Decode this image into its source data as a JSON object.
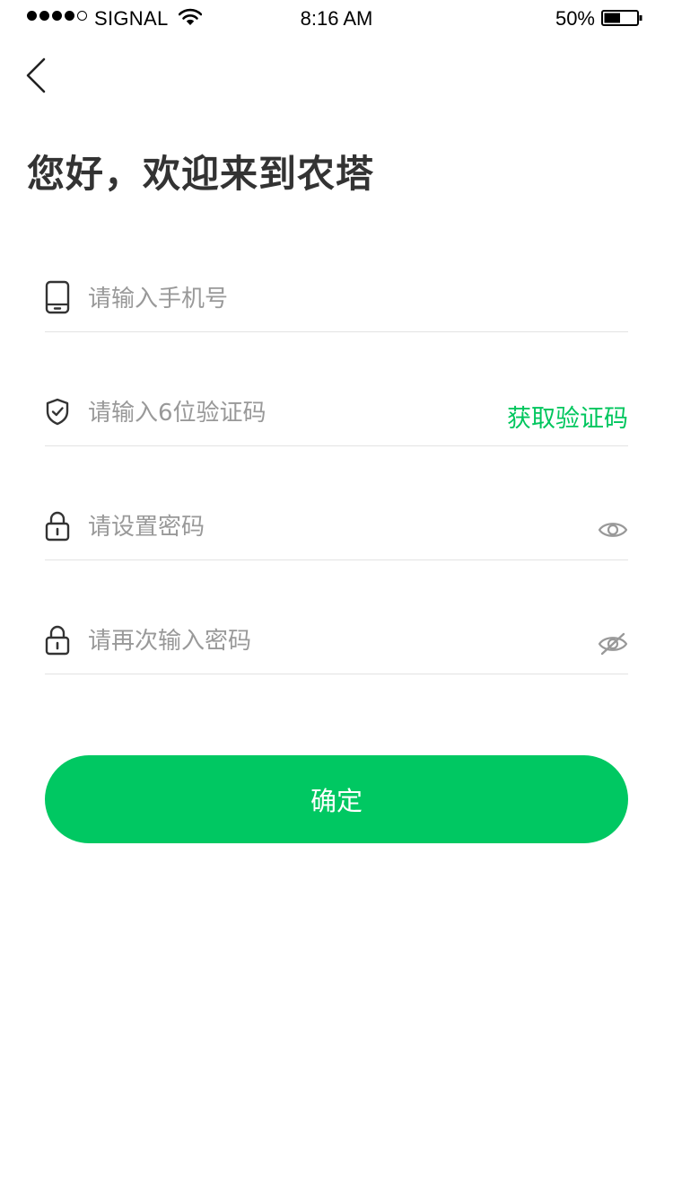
{
  "status_bar": {
    "carrier": "SIGNAL",
    "time": "8:16 AM",
    "battery_percent": "50%",
    "battery_level": 0.5,
    "signal_strength": 4,
    "signal_max": 5
  },
  "header": {
    "title": "您好，欢迎来到农塔"
  },
  "form": {
    "phone": {
      "placeholder": "请输入手机号",
      "value": "",
      "icon": "phone-icon"
    },
    "code": {
      "placeholder": "请输入6位验证码",
      "value": "",
      "icon": "shield-check-icon",
      "get_code_label": "获取验证码"
    },
    "password": {
      "placeholder": "请设置密码",
      "value": "",
      "icon": "lock-icon",
      "toggle_icon": "eye-icon"
    },
    "password_confirm": {
      "placeholder": "请再次输入密码",
      "value": "",
      "icon": "lock-icon",
      "toggle_icon": "eye-off-icon"
    },
    "submit_label": "确定"
  },
  "colors": {
    "accent": "#00c862",
    "link": "#00c65e",
    "title": "#333333",
    "placeholder": "#999999",
    "divider": "#e3e3e3",
    "icon": "#333333",
    "toggle_icon": "#999999"
  }
}
